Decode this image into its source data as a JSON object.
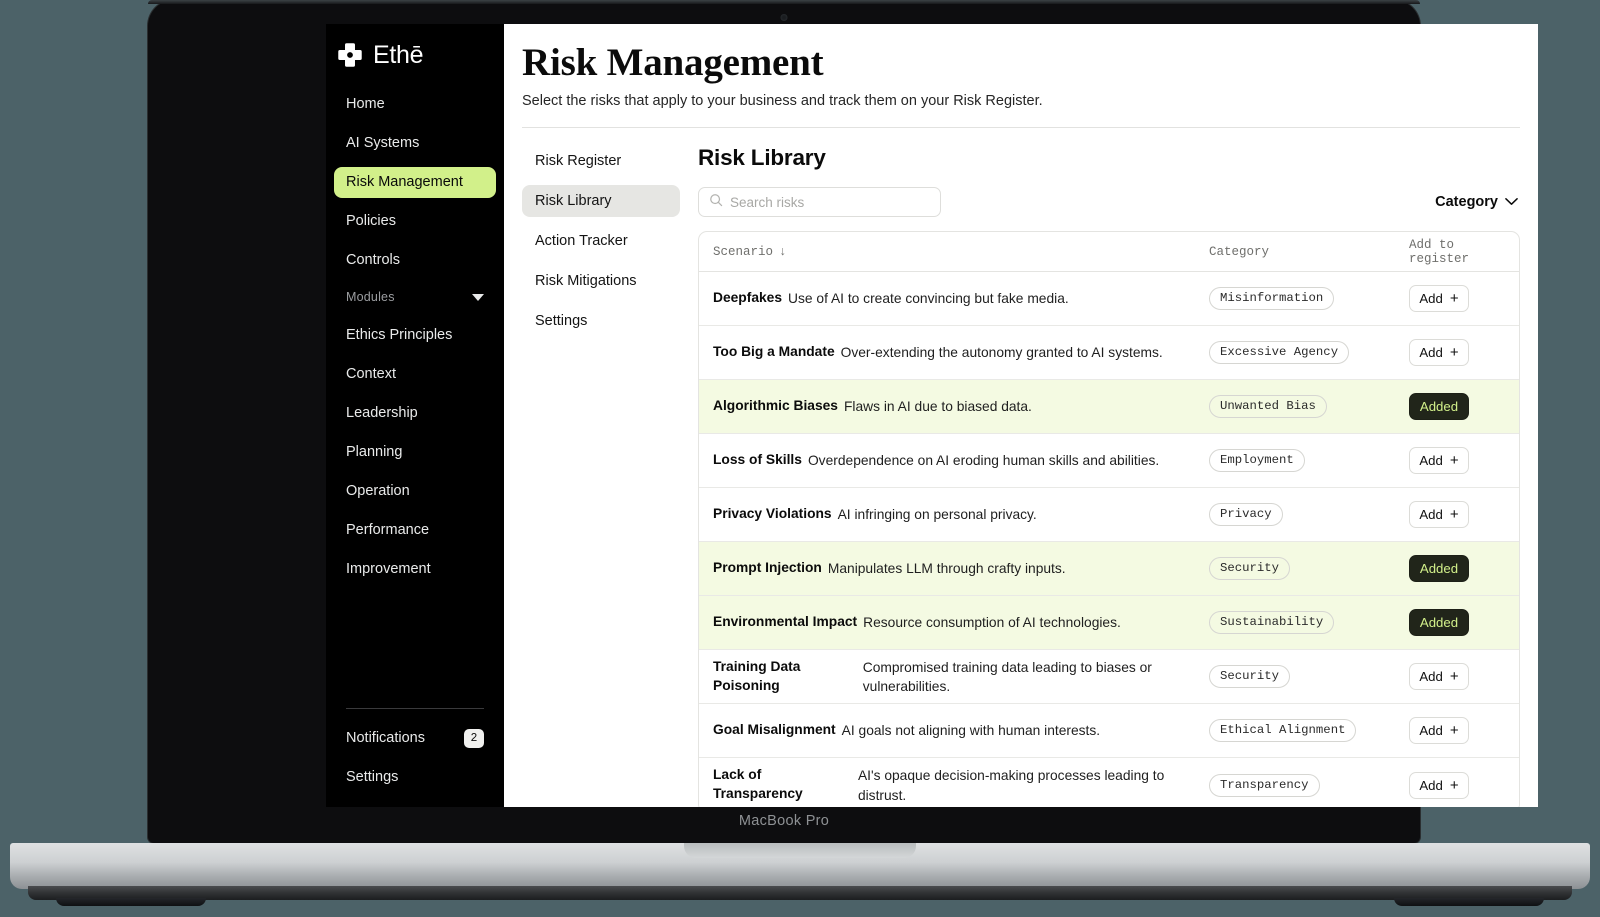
{
  "device": {
    "label": "MacBook Pro"
  },
  "brand": {
    "name": "Ethē",
    "logo_icon": "ethe-cross-logo"
  },
  "sidebar": {
    "items": [
      {
        "label": "Home",
        "active": false
      },
      {
        "label": "AI Systems",
        "active": false
      },
      {
        "label": "Risk Management",
        "active": true
      },
      {
        "label": "Policies",
        "active": false
      },
      {
        "label": "Controls",
        "active": false
      }
    ],
    "group": {
      "label": "Modules",
      "expanded": true
    },
    "module_items": [
      {
        "label": "Ethics Principles"
      },
      {
        "label": "Context"
      },
      {
        "label": "Leadership"
      },
      {
        "label": "Planning"
      },
      {
        "label": "Operation"
      },
      {
        "label": "Performance"
      },
      {
        "label": "Improvement"
      }
    ],
    "bottom": {
      "notifications_label": "Notifications",
      "notifications_count": "2",
      "settings_label": "Settings"
    },
    "accent_color": "#d2f08a"
  },
  "header": {
    "title": "Risk Management",
    "subtitle": "Select the risks that apply to your business and track them on your Risk Register."
  },
  "subnav": {
    "items": [
      {
        "label": "Risk Register",
        "active": false
      },
      {
        "label": "Risk Library",
        "active": true
      },
      {
        "label": "Action Tracker",
        "active": false
      },
      {
        "label": "Risk Mitigations",
        "active": false
      },
      {
        "label": "Settings",
        "active": false
      }
    ]
  },
  "content": {
    "title": "Risk Library",
    "search": {
      "placeholder": "Search risks",
      "value": ""
    },
    "category_filter": {
      "label": "Category"
    },
    "table": {
      "headers": {
        "scenario": "Scenario",
        "sort_indicator": "↓",
        "category": "Category",
        "action": "Add to register"
      },
      "add_label": "Add",
      "added_label": "Added",
      "rows": [
        {
          "title": "Deepfakes",
          "desc": "Use of AI to create convincing but fake media.",
          "category": "Misinformation",
          "added": false
        },
        {
          "title": "Too Big a Mandate",
          "desc": "Over-extending the autonomy granted to AI systems.",
          "category": "Excessive Agency",
          "added": false
        },
        {
          "title": "Algorithmic Biases",
          "desc": "Flaws in AI due to biased data.",
          "category": "Unwanted Bias",
          "added": true
        },
        {
          "title": "Loss of Skills",
          "desc": "Overdependence on AI eroding human skills and abilities.",
          "category": "Employment",
          "added": false
        },
        {
          "title": "Privacy Violations",
          "desc": "AI infringing on personal privacy.",
          "category": "Privacy",
          "added": false
        },
        {
          "title": "Prompt Injection",
          "desc": "Manipulates LLM through crafty inputs.",
          "category": "Security",
          "added": true
        },
        {
          "title": "Environmental Impact",
          "desc": "Resource consumption of AI technologies.",
          "category": "Sustainability",
          "added": true
        },
        {
          "title": "Training Data Poisoning",
          "desc": "Compromised training data leading to biases or vulnerabilities.",
          "category": "Security",
          "added": false
        },
        {
          "title": "Goal Misalignment",
          "desc": "AI goals not aligning with human interests.",
          "category": "Ethical Alignment",
          "added": false
        },
        {
          "title": "Lack of Transparency",
          "desc": "AI's opaque decision-making processes leading to distrust.",
          "category": "Transparency",
          "added": false
        }
      ]
    }
  }
}
